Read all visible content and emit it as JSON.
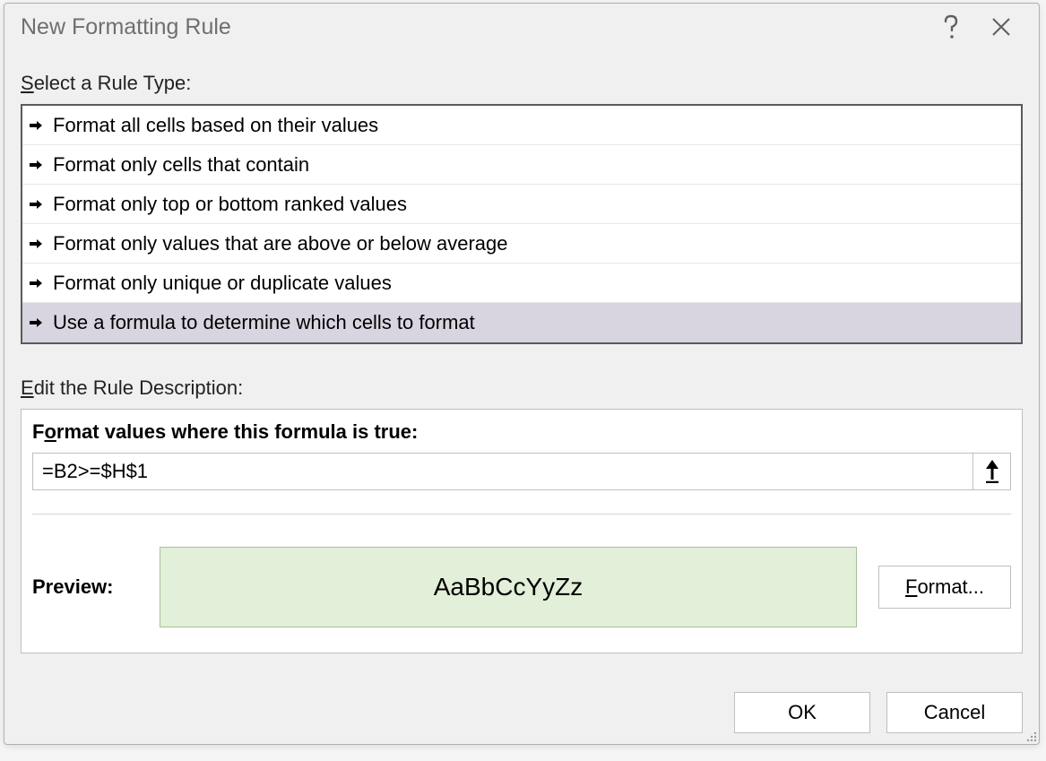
{
  "dialog": {
    "title": "New Formatting Rule",
    "select_rule_label": "Select a Rule Type:",
    "rule_types": [
      "Format all cells based on their values",
      "Format only cells that contain",
      "Format only top or bottom ranked values",
      "Format only values that are above or below average",
      "Format only unique or duplicate values",
      "Use a formula to determine which cells to format"
    ],
    "selected_index": 5,
    "edit_label": "Edit the Rule Description:",
    "formula_heading_prefix": "F",
    "formula_heading_underline": "o",
    "formula_heading_suffix": "rmat values where this formula is true:",
    "formula_value": "=B2>=$H$1",
    "preview_label": "Preview:",
    "preview_sample": "AaBbCcYyZz",
    "format_btn_underline": "F",
    "format_btn_suffix": "ormat...",
    "ok_label": "OK",
    "cancel_label": "Cancel"
  }
}
